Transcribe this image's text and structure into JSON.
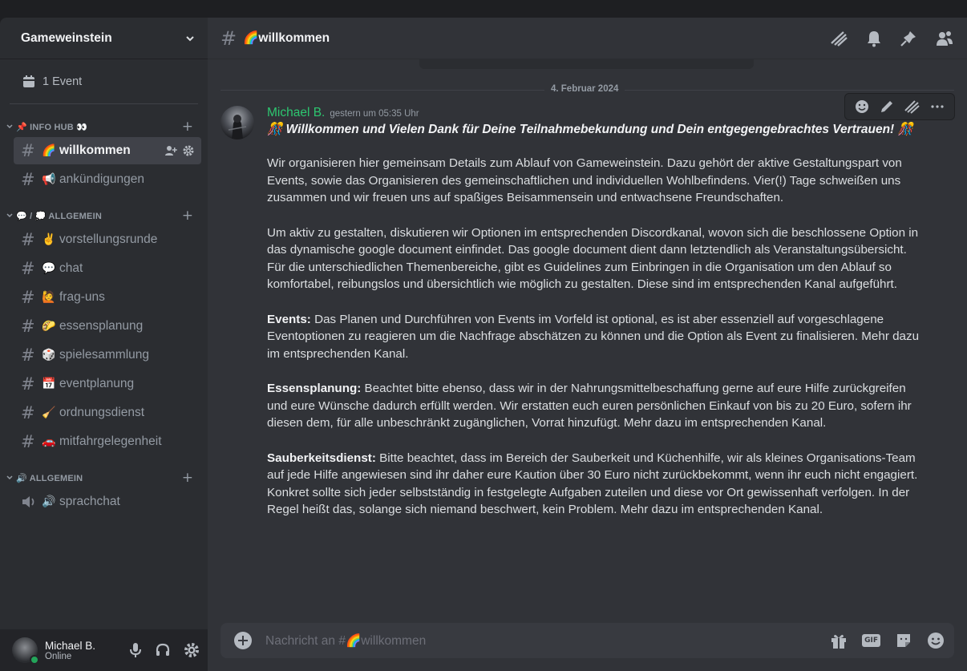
{
  "server": {
    "name": "Gameweinstein",
    "events_label": "1 Event"
  },
  "categories": [
    {
      "name": "📌 INFO HUB 👀",
      "channels": [
        {
          "emoji": "🌈",
          "name": "willkommen",
          "active": true
        },
        {
          "emoji": "📢",
          "name": "ankündigungen"
        }
      ]
    },
    {
      "name": "💬 / 💭 ALLGEMEIN",
      "channels": [
        {
          "emoji": "✌️",
          "name": "vorstellungsrunde"
        },
        {
          "emoji": "💬",
          "name": "chat"
        },
        {
          "emoji": "🙋",
          "name": "frag-uns"
        },
        {
          "emoji": "🌮",
          "name": "essensplanung"
        },
        {
          "emoji": "🎲",
          "name": "spielesammlung"
        },
        {
          "emoji": "📅",
          "name": "eventplanung"
        },
        {
          "emoji": "🧹",
          "name": "ordnungsdienst"
        },
        {
          "emoji": "🚗",
          "name": "mitfahrgelegenheit"
        }
      ]
    },
    {
      "name": "🔊 ALLGEMEIN",
      "channels": [
        {
          "emoji": "🔊",
          "name": "sprachchat",
          "voice": true
        }
      ]
    }
  ],
  "user": {
    "name": "Michael B.",
    "status": "Online"
  },
  "channel_header": {
    "title": "🌈willkommen"
  },
  "divider_date": "4. Februar 2024",
  "message": {
    "author": "Michael B.",
    "timestamp": "gestern um 05:35 Uhr",
    "title": "🎊 Willkommen und Vielen Dank für Deine Teilnahmebekundung und Dein entgegengebrachtes Vertrauen! 🎊",
    "p1": "Wir organisieren hier gemeinsam Details zum Ablauf von Gameweinstein. Dazu gehört der aktive Gestaltungspart von Events, sowie das Organisieren des gemeinschaftlichen und individuellen Wohlbefindens. Vier(!) Tage schweißen uns zusammen und wir freuen uns auf spaßiges Beisammensein und entwachsene Freundschaften.",
    "p2": "Um aktiv zu gestalten, diskutieren wir Optionen im entsprechenden Discordkanal, wovon sich die beschlossene Option in das dynamische google document einfindet. Das google document dient dann letztendlich als Veranstaltungsübersicht. Für die unterschiedlichen Themenbereiche, gibt es Guidelines zum Einbringen in die Organisation um den Ablauf so komfortabel, reibungslos und übersichtlich wie möglich zu gestalten. Diese sind im entsprechenden Kanal aufgeführt.",
    "p3_label": "Events:",
    "p3": " Das Planen und Durchführen von Events im Vorfeld ist optional, es ist aber essenziell auf vorgeschlagene Eventoptionen zu reagieren um die Nachfrage abschätzen zu können und die Option als Event zu finalisieren. Mehr dazu im entsprechenden Kanal.",
    "p4_label": "Essensplanung:",
    "p4": " Beachtet bitte ebenso, dass wir in der Nahrungsmittelbeschaffung gerne auf eure Hilfe zurückgreifen und eure Wünsche dadurch erfüllt werden. Wir erstatten euch euren persönlichen Einkauf von bis zu 20 Euro, sofern ihr diesen dem, für alle unbeschränkt zugänglichen, Vorrat hinzufügt. Mehr dazu im entsprechenden Kanal.",
    "p5_label": "Sauberkeitsdienst:",
    "p5": " Bitte beachtet, dass im Bereich der Sauberkeit und Küchenhilfe, wir als kleines Organisations-Team auf jede Hilfe angewiesen sind ihr daher eure Kaution über 30 Euro nicht zurückbekommt, wenn ihr euch nicht engagiert. Konkret sollte sich jeder selbstständig in festgelegte Aufgaben zuteilen und diese vor Ort gewissenhaft verfolgen. In der Regel heißt das, solange sich niemand beschwert, kein Problem. Mehr dazu im entsprechenden Kanal."
  },
  "composer": {
    "placeholder": "Nachricht an #🌈willkommen",
    "gif_label": "GIF"
  },
  "icons": {
    "chevron": "chevron-down-icon",
    "calendar": "calendar-icon",
    "threads": "threads-icon",
    "bell": "bell-icon",
    "pin": "pin-icon",
    "members": "members-icon"
  },
  "colors": {
    "accent_online": "#23a55a",
    "author": "#2dc770",
    "bg_main": "#313338",
    "bg_sidebar": "#2b2d31"
  }
}
